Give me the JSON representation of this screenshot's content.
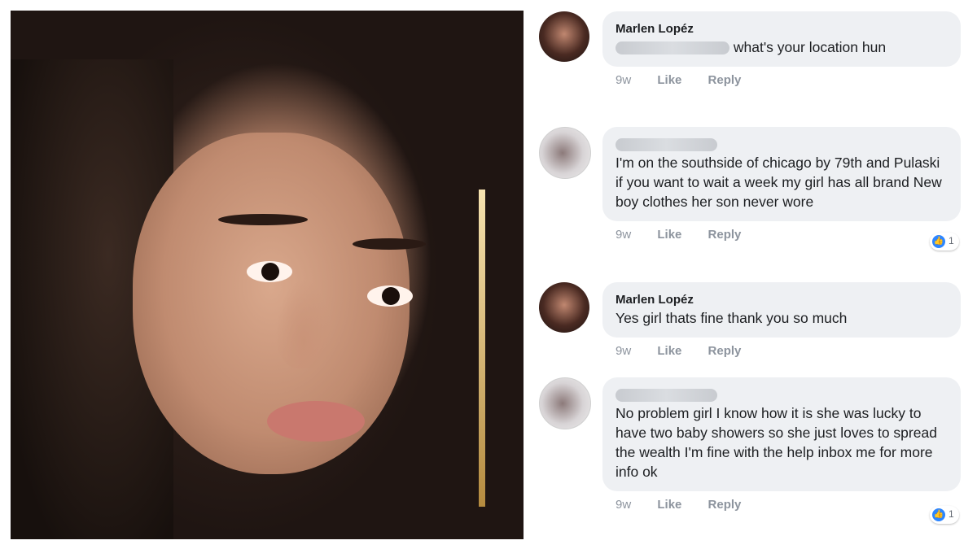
{
  "comments": [
    {
      "author": "Marlen Lopéz",
      "text": "what's your location hun",
      "time": "9w",
      "like": "Like",
      "reply": "Reply"
    },
    {
      "author": "",
      "text": "I'm on the southside of chicago by 79th and Pulaski if you want to wait a week my girl has all brand New boy clothes her son never wore",
      "time": "9w",
      "like": "Like",
      "reply": "Reply",
      "reactions": "1"
    },
    {
      "author": "Marlen Lopéz",
      "text": "Yes girl thats fine thank you so much",
      "time": "9w",
      "like": "Like",
      "reply": "Reply"
    },
    {
      "author": "",
      "text": "No problem girl I know how it is she was lucky to have two baby showers so she just loves to spread the wealth I'm fine with the help inbox me for more info ok",
      "time": "9w",
      "like": "Like",
      "reply": "Reply",
      "reactions": "1"
    }
  ],
  "icons": {
    "reaction": "like-thumb-icon"
  },
  "colors": {
    "bubble": "#eef0f3",
    "meta_text": "#8d949e",
    "like_blue": "#2d86ff"
  }
}
